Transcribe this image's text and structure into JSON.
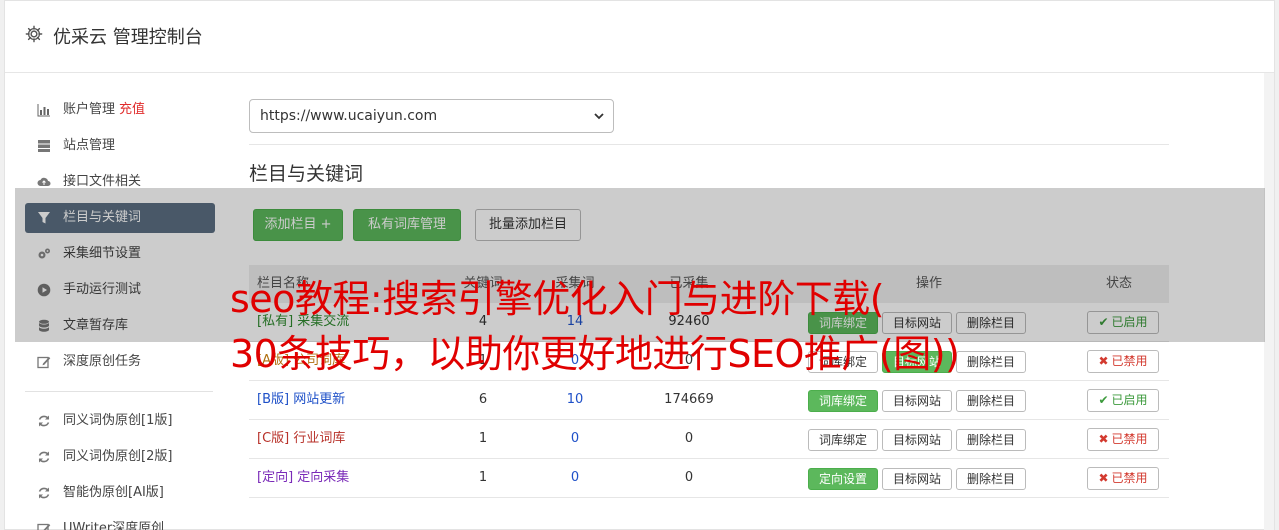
{
  "header": {
    "title": "优采云 管理控制台",
    "icon": "gear-icon"
  },
  "sidebar": {
    "items": [
      {
        "label": "账户管理",
        "extra": "充值",
        "icon": "bar-chart-icon"
      },
      {
        "label": "站点管理",
        "icon": "server-icon"
      },
      {
        "label": "接口文件相关",
        "icon": "cloud-upload-icon"
      },
      {
        "label": "栏目与关键词",
        "icon": "filter-icon",
        "active": true
      },
      {
        "label": "采集细节设置",
        "icon": "gears-icon"
      },
      {
        "label": "手动运行测试",
        "icon": "play-circle-icon"
      },
      {
        "label": "文章暂存库",
        "icon": "database-icon"
      },
      {
        "label": "深度原创任务",
        "icon": "edit-icon"
      }
    ],
    "items2": [
      {
        "label": "同义词伪原创[1版]",
        "icon": "refresh-icon"
      },
      {
        "label": "同义词伪原创[2版]",
        "icon": "refresh-icon"
      },
      {
        "label": "智能伪原创[AI版]",
        "icon": "refresh-icon"
      },
      {
        "label": "UWriter深度原创",
        "icon": "edit-icon"
      }
    ]
  },
  "main": {
    "site_select": "https://www.ucaiyun.com",
    "section_title": "栏目与关键词",
    "buttons": {
      "add_column": "添加栏目 +",
      "private_lib": "私有词库管理",
      "batch_add": "批量添加栏目"
    },
    "table": {
      "headers": [
        "栏目名称",
        "关键词",
        "已采集",
        "操作",
        "状态"
      ],
      "headers_partial": {
        "c2": "关键词",
        "c3": "采集词",
        "op": "操作"
      },
      "rows": [
        {
          "name": "[私有] 采集交流",
          "kw": "4",
          "cw": "14",
          "collected": "92460",
          "b1": "词库绑定",
          "b2": "目标网站",
          "b3": "删除栏目",
          "status": "已启用",
          "on": true,
          "color": "#2f8a2f",
          "b1green": true
        },
        {
          "name": "[A版] 公司词库",
          "kw": "1",
          "cw": "0",
          "collected": "0",
          "b1": "词库绑定",
          "b2": "目标网站",
          "b3": "删除栏目",
          "status": "已禁用",
          "on": false,
          "color": "#b07010",
          "b1green": false,
          "b2green": true
        },
        {
          "name": "[B版] 网站更新",
          "kw": "6",
          "cw": "10",
          "collected": "174669",
          "b1": "词库绑定",
          "b2": "目标网站",
          "b3": "删除栏目",
          "status": "已启用",
          "on": true,
          "color": "#1e50c8",
          "b1green": true
        },
        {
          "name": "[C版] 行业词库",
          "kw": "1",
          "cw": "0",
          "collected": "0",
          "b1": "词库绑定",
          "b2": "目标网站",
          "b3": "删除栏目",
          "status": "已禁用",
          "on": false,
          "color": "#b8322a",
          "b1green": false
        },
        {
          "name": "[定向] 定向采集",
          "kw": "1",
          "cw": "0",
          "collected": "0",
          "b1": "定向设置",
          "b2": "目标网站",
          "b3": "删除栏目",
          "status": "已禁用",
          "on": false,
          "color": "#7a2ab8",
          "b1green": true
        }
      ]
    }
  },
  "overlay": {
    "line1": "seo教程:搜索引擎优化入门与进阶下载(",
    "line2": "30条技巧，以助你更好地进行SEO推广(图))"
  },
  "colors": {
    "green": "#5cb85c",
    "active_nav": "#5c6f82",
    "red": "#e00000"
  }
}
